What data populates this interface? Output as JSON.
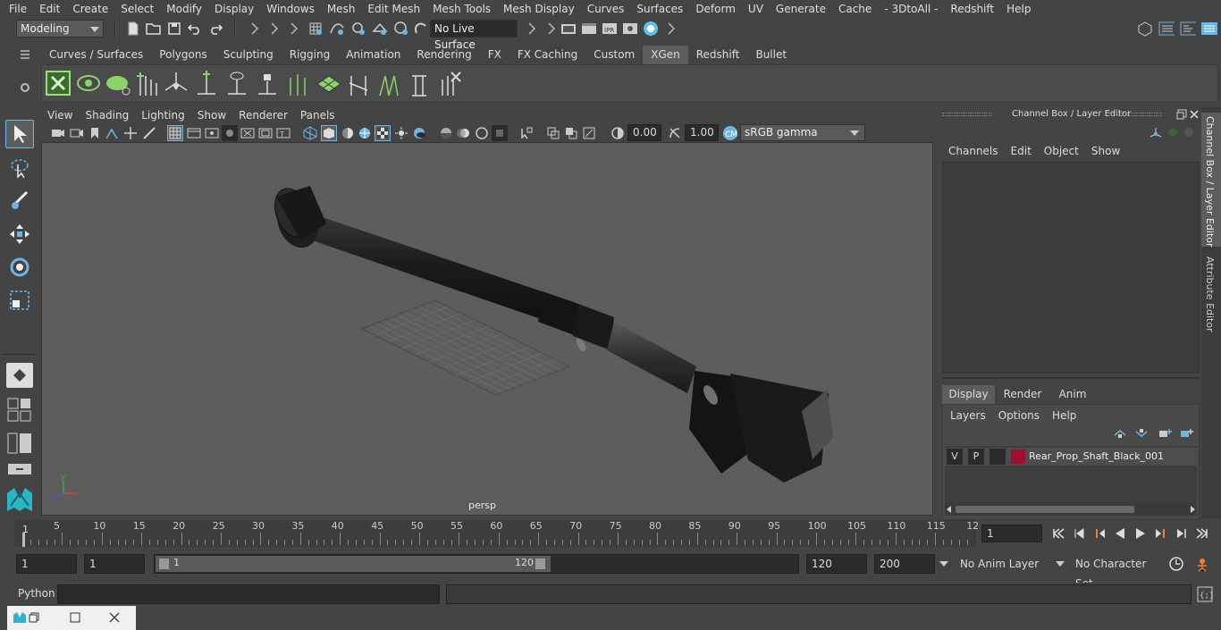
{
  "menubar": {
    "items": [
      "File",
      "Edit",
      "Create",
      "Select",
      "Modify",
      "Display",
      "Windows",
      "Mesh",
      "Edit Mesh",
      "Mesh Tools",
      "Mesh Display",
      "Curves",
      "Surfaces",
      "Deform",
      "UV",
      "Generate",
      "Cache",
      "- 3DtoAll -",
      "Redshift",
      "Help"
    ]
  },
  "statusline": {
    "mode": "Modeling",
    "live_surface": "No Live Surface"
  },
  "shelf": {
    "tabs": [
      "Curves / Surfaces",
      "Polygons",
      "Sculpting",
      "Rigging",
      "Animation",
      "Rendering",
      "FX",
      "FX Caching",
      "Custom",
      "XGen",
      "Redshift",
      "Bullet"
    ],
    "active_tab": "XGen"
  },
  "viewport": {
    "menu": [
      "View",
      "Shading",
      "Lighting",
      "Show",
      "Renderer",
      "Panels"
    ],
    "exposure": "0.00",
    "gamma": "1.00",
    "colorspace": "sRGB gamma",
    "camera_label": "persp"
  },
  "channelbox": {
    "title": "Channel Box / Layer Editor",
    "menu": [
      "Channels",
      "Edit",
      "Object",
      "Show"
    ],
    "side_tab_1": "Channel Box / Layer Editor",
    "side_tab_2": "Attribute Editor"
  },
  "layer_editor": {
    "tabs": [
      "Display",
      "Render",
      "Anim"
    ],
    "active_tab": "Display",
    "menu": [
      "Layers",
      "Options",
      "Help"
    ],
    "layers": [
      {
        "v": "V",
        "p": "P",
        "color": "#a0102c",
        "name": "Rear_Prop_Shaft_Black_001"
      }
    ]
  },
  "timeline": {
    "ticks": [
      "5",
      "10",
      "15",
      "20",
      "25",
      "30",
      "35",
      "40",
      "45",
      "50",
      "55",
      "60",
      "65",
      "70",
      "75",
      "80",
      "85",
      "90",
      "95",
      "100",
      "105",
      "110",
      "115",
      "12"
    ],
    "start_marker": "1",
    "current_frame": "1"
  },
  "range": {
    "start": "1",
    "playback_start": "1",
    "slider_start": "1",
    "slider_end": "120",
    "playback_end": "120",
    "end": "200",
    "anim_layer": "No Anim Layer",
    "character_set": "No Character Set"
  },
  "cmdline": {
    "label": "Python"
  }
}
